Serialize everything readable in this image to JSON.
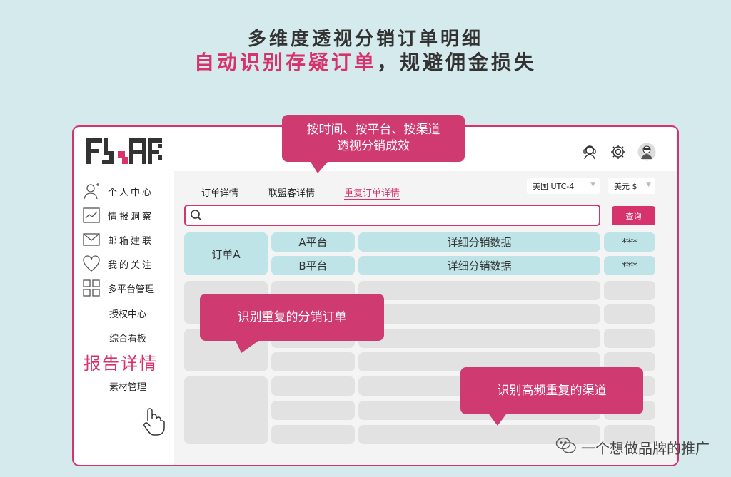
{
  "headline": {
    "line1": "多维度透视分销订单明细",
    "line2_highlight": "自动识别存疑订单",
    "line2_rest": "，规避佣金损失"
  },
  "colors": {
    "accent": "#d6336c",
    "teal_cell": "#bfe4e7",
    "gray_cell": "#e2e2e2",
    "background": "#d5eaec"
  },
  "header": {
    "icons": [
      "support-agent-icon",
      "gear-icon",
      "avatar"
    ]
  },
  "sidebar": {
    "items": [
      {
        "label": "个人中心",
        "icon": "user-icon"
      },
      {
        "label": "情报洞察",
        "icon": "chart-icon"
      },
      {
        "label": "邮箱建联",
        "icon": "mail-icon"
      },
      {
        "label": "我的关注",
        "icon": "heart-icon"
      },
      {
        "label": "多平台管理",
        "icon": "grid-icon"
      }
    ],
    "sub_items": [
      "授权中心",
      "综合看板"
    ],
    "active_item": "报告详情",
    "last_item": "素材管理"
  },
  "tabs": [
    {
      "label": "订单详情"
    },
    {
      "label": "联盟客详情"
    },
    {
      "label": "重复订单详情"
    }
  ],
  "filters": {
    "timezone": "美国 UTC-4",
    "currency": "美元 $"
  },
  "search": {
    "placeholder": "",
    "button_label": "查询"
  },
  "table": {
    "order": "订单A",
    "rows": [
      {
        "platform": "A平台",
        "detail": "详细分销数据",
        "masked": "***"
      },
      {
        "platform": "B平台",
        "detail": "详细分销数据",
        "masked": "***"
      }
    ]
  },
  "callouts": {
    "top_line1": "按时间、按平台、按渠道",
    "top_line2": "透视分销成效",
    "middle": "识别重复的分销订单",
    "bottom": "识别高频重复的渠道"
  },
  "watermark": "一个想做品牌的推广"
}
